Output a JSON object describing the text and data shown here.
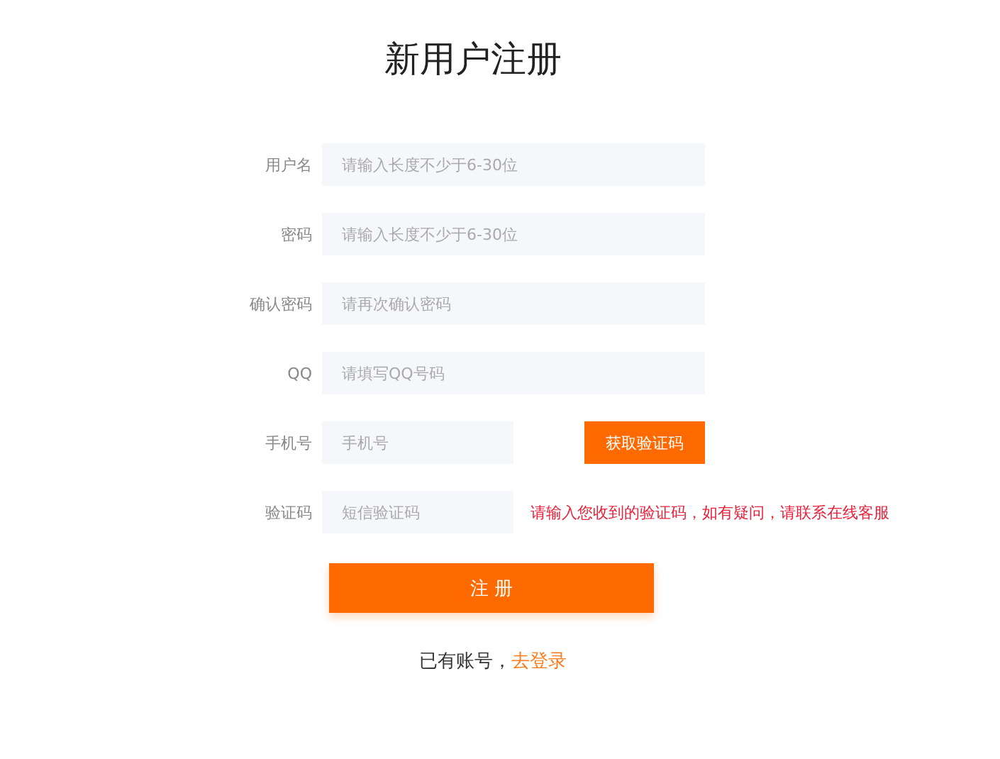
{
  "title": "新用户注册",
  "fields": [
    {
      "kind": "plain",
      "label": "用户名",
      "placeholder": "请输入长度不少于6-30位"
    },
    {
      "kind": "plain",
      "label": "密码",
      "placeholder": "请输入长度不少于6-30位"
    },
    {
      "kind": "plain",
      "label": "确认密码",
      "placeholder": "请再次确认密码"
    },
    {
      "kind": "plain",
      "label": "QQ",
      "placeholder": "请填写QQ号码"
    },
    {
      "kind": "button",
      "label": "手机号",
      "placeholder": "手机号",
      "button": "获取验证码"
    },
    {
      "kind": "hint",
      "label": "验证码",
      "placeholder": "短信验证码",
      "hint": "请输入您收到的验证码，如有疑问，请联系在线客服"
    }
  ],
  "submit": "注 册",
  "login_prompt": {
    "text": "已有账号，",
    "link": "去登录"
  }
}
